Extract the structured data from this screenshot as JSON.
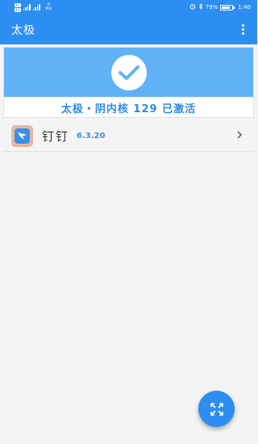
{
  "status_bar": {
    "sim1": "4G",
    "sim2": "4G",
    "net_speed_value": "0",
    "net_speed_unit": "K/s",
    "battery_text": "79%",
    "battery_level": 0.79,
    "time": "1:40"
  },
  "app_bar": {
    "title": "太极"
  },
  "status_card": {
    "status_text": "太极・阴内核 129 已激活"
  },
  "modules": [
    {
      "name": "钉钉",
      "version": "6.3.20"
    }
  ],
  "colors": {
    "primary": "#2b8ef0",
    "banner": "#60b1f6",
    "accent_text": "#2d8be6"
  },
  "icons": {
    "check": "check-circle-icon",
    "fab": "expand-arrows-icon",
    "chevron": "chevron-right-icon",
    "overflow": "more-vert-icon"
  }
}
